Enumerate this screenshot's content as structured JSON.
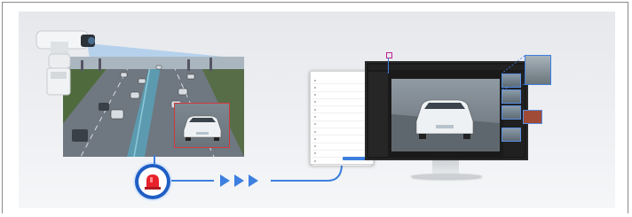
{
  "menu": {
    "items": [
      "",
      "",
      "",
      "",
      "",
      "",
      "",
      "",
      "",
      "",
      "",
      "",
      "",
      "",
      "",
      "",
      "",
      "",
      "",
      ""
    ]
  },
  "colors": {
    "accent": "#3d7fe0",
    "alarm": "#e8222b",
    "alarm_ring": "#1f5ec4",
    "highlight_box": "#d0383f",
    "monitor_bezel": "#1a1a1a"
  },
  "icons": {
    "camera": "ptz-camera-icon",
    "alarm": "alarm-siren-icon",
    "arrows": "triple-arrow-icon",
    "monitor": "monitor-icon"
  }
}
